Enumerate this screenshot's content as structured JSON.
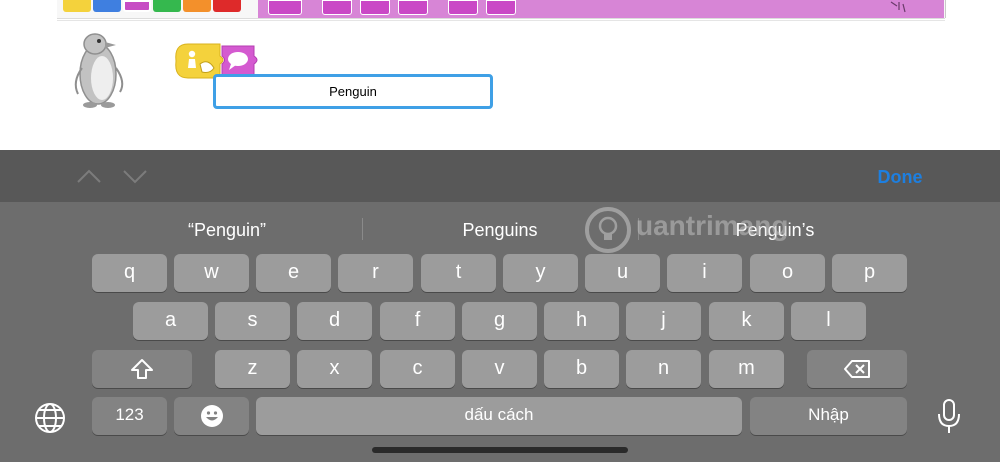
{
  "app": {
    "category_colors": [
      "#f4d23c",
      "#3f7fe0",
      "#c74cc4",
      "#35b84e",
      "#f3902b",
      "#de2a2a"
    ],
    "block_color": "#ca48c6",
    "name_field": {
      "value": "Penguin"
    }
  },
  "accessory_bar": {
    "done_label": "Done"
  },
  "keyboard": {
    "suggestions": [
      "“Penguin”",
      "Penguins",
      "Penguin’s"
    ],
    "row1": [
      "q",
      "w",
      "e",
      "r",
      "t",
      "y",
      "u",
      "i",
      "o",
      "p"
    ],
    "row2": [
      "a",
      "s",
      "d",
      "f",
      "g",
      "h",
      "j",
      "k",
      "l"
    ],
    "row3": [
      "z",
      "x",
      "c",
      "v",
      "b",
      "n",
      "m"
    ],
    "numbers_label": "123",
    "space_label": "dấu cách",
    "return_label": "Nhập"
  },
  "watermark": {
    "text": "uantrimang"
  }
}
